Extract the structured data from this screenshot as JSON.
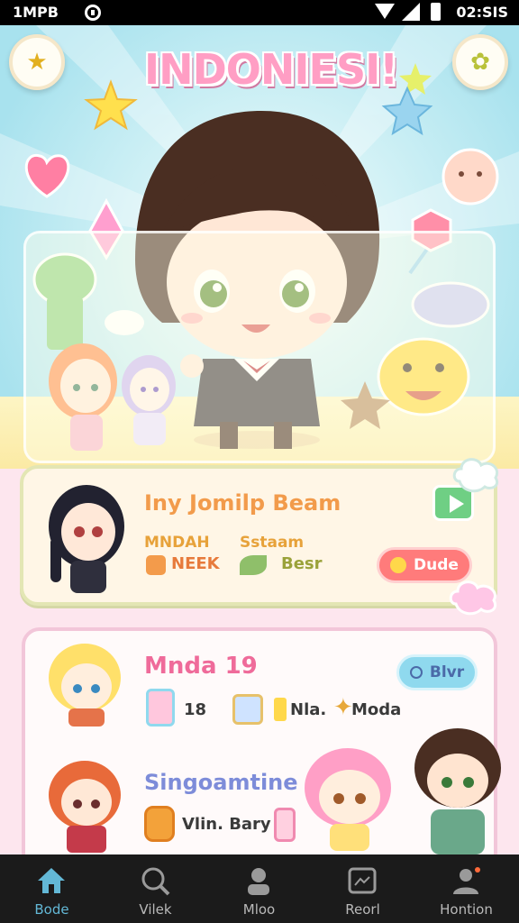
{
  "status_bar": {
    "left_text": "1MPB",
    "time": "02:SIS"
  },
  "header": {
    "title": "INDONIESI!"
  },
  "card1": {
    "title": "Iny Jomilp Beam",
    "stat1": "MNDAH",
    "stat1_sub": "NEEK",
    "stat2": "Sstaam",
    "stat2_sub": "Besr",
    "button": "Dude"
  },
  "card2": {
    "title": "Mnda 19",
    "button": "Blvr",
    "item1_value": "18",
    "item2_value": "Nla.",
    "item3_value": "Moda",
    "subtitle": "Singoamtine",
    "item4_value": "Vlin. Bary"
  },
  "nav": {
    "items": [
      {
        "label": "Bode",
        "icon": "home-icon",
        "active": true
      },
      {
        "label": "Vilek",
        "icon": "search-icon",
        "active": false
      },
      {
        "label": "Mloo",
        "icon": "user-icon",
        "active": false
      },
      {
        "label": "Reorl",
        "icon": "photo-icon",
        "active": false
      },
      {
        "label": "Hontion",
        "icon": "profile-icon",
        "active": false
      }
    ]
  },
  "colors": {
    "accent": "#63b8d6",
    "title_pink": "#ff9ec4",
    "card_border": "#e3e6b4",
    "nav_bg": "#1b1b1b"
  }
}
